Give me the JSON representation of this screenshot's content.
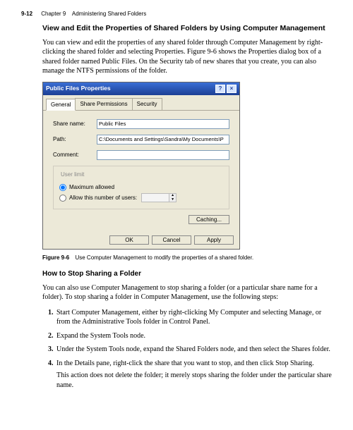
{
  "header": {
    "page_number": "9-12",
    "chapter": "Chapter 9",
    "chapter_title": "Administering Shared Folders"
  },
  "section1": {
    "heading": "View and Edit the Properties of Shared Folders by Using Computer Management",
    "para": "You can view and edit the properties of any shared folder through Computer Management by right-clicking the shared folder and selecting Properties. Figure 9-6 shows the Properties dialog box of a shared folder named Public Files. On the Security tab of new shares that you create, you can also manage the NTFS permissions of the folder."
  },
  "dialog": {
    "title": "Public Files Properties",
    "help_btn": "?",
    "close_btn": "×",
    "tabs": {
      "general": "General",
      "share_perm": "Share Permissions",
      "security": "Security"
    },
    "labels": {
      "share_name": "Share name:",
      "path": "Path:",
      "comment": "Comment:"
    },
    "values": {
      "share_name": "Public Files",
      "path": "C:\\Documents and Settings\\Sandra\\My Documents\\P",
      "comment": ""
    },
    "fieldset": {
      "legend": "User limit",
      "radio_max": "Maximum allowed",
      "radio_allow": "Allow this number of users:"
    },
    "buttons": {
      "caching": "Caching...",
      "ok": "OK",
      "cancel": "Cancel",
      "apply": "Apply"
    }
  },
  "figure": {
    "num": "Figure 9-6",
    "caption": "Use Computer Management to modify the properties of a shared folder."
  },
  "section2": {
    "heading": "How to Stop Sharing a Folder",
    "para": "You can also use Computer Management to stop sharing a folder (or a particular share name for a folder). To stop sharing a folder in Computer Management, use the following steps:",
    "steps": [
      "Start Computer Management, either by right-clicking My Computer and selecting Manage, or from the Administrative Tools folder in Control Panel.",
      "Expand the System Tools node.",
      "Under the System Tools node, expand the Shared Folders node, and then select the Shares folder.",
      "In the Details pane, right-click the share that you want to stop, and then click Stop Sharing."
    ],
    "followup": "This action does not delete the folder; it merely stops sharing the folder under the particular share name."
  }
}
